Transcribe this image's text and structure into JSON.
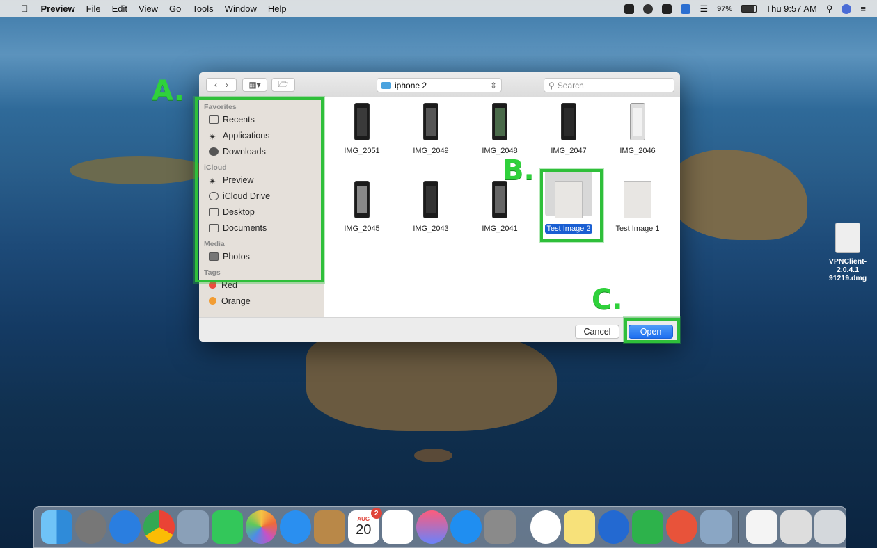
{
  "menubar": {
    "apple": "",
    "app": "Preview",
    "menus": [
      "File",
      "Edit",
      "View",
      "Go",
      "Tools",
      "Window",
      "Help"
    ],
    "battery": "97%",
    "clock": "Thu 9:57 AM"
  },
  "dialog": {
    "location": "iphone 2",
    "search_placeholder": "Search",
    "sidebar": {
      "favorites_header": "Favorites",
      "favorites": [
        "Recents",
        "Applications",
        "Downloads"
      ],
      "icloud_header": "iCloud",
      "icloud": [
        "Preview",
        "iCloud Drive",
        "Desktop",
        "Documents"
      ],
      "media_header": "Media",
      "media": [
        "Photos"
      ],
      "tags_header": "Tags",
      "tags": [
        {
          "label": "Red",
          "color": "#ef4c3f"
        },
        {
          "label": "Orange",
          "color": "#f29d33"
        }
      ]
    },
    "files": [
      {
        "name": "IMG_2051",
        "kind": "phone"
      },
      {
        "name": "IMG_2049",
        "kind": "phone"
      },
      {
        "name": "IMG_2048",
        "kind": "phone"
      },
      {
        "name": "IMG_2047",
        "kind": "phone"
      },
      {
        "name": "IMG_2046",
        "kind": "phone"
      },
      {
        "name": "IMG_2045",
        "kind": "phone"
      },
      {
        "name": "IMG_2043",
        "kind": "phone"
      },
      {
        "name": "IMG_2041",
        "kind": "phone"
      },
      {
        "name": "Test Image 2",
        "kind": "doc",
        "selected": true
      },
      {
        "name": "Test Image 1",
        "kind": "doc"
      }
    ],
    "cancel_label": "Cancel",
    "open_label": "Open"
  },
  "annotations": {
    "a": "A.",
    "b": "B.",
    "c": "C."
  },
  "desktop_file": "VPNClient-2.0.4.1\n91219.dmg",
  "dock": {
    "calendar_month": "AUG",
    "calendar_day": "20",
    "calendar_badge": "2"
  },
  "colors": {
    "annotation": "#2fbf3a",
    "selection": "#1a5fd2",
    "open_button": "#1d6ef0"
  }
}
